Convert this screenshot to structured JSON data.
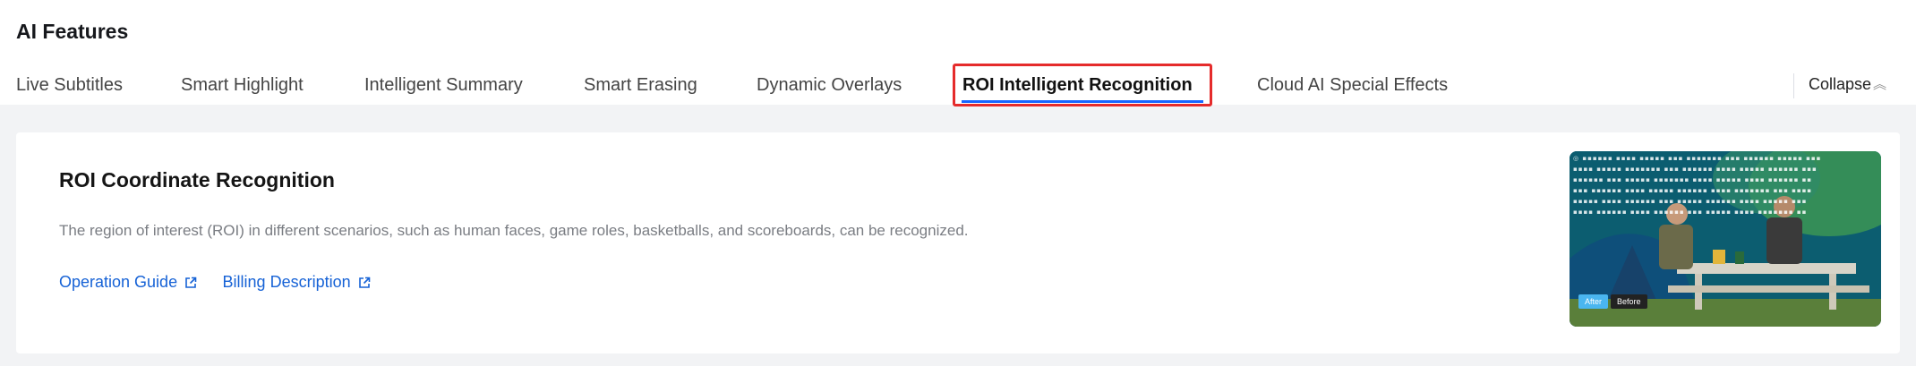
{
  "page": {
    "title": "AI Features"
  },
  "tabs": [
    {
      "label": "Live Subtitles",
      "active": false
    },
    {
      "label": "Smart Highlight",
      "active": false
    },
    {
      "label": "Intelligent Summary",
      "active": false
    },
    {
      "label": "Smart Erasing",
      "active": false
    },
    {
      "label": "Dynamic Overlays",
      "active": false
    },
    {
      "label": "ROI Intelligent Recognition",
      "active": true
    },
    {
      "label": "Cloud AI Special Effects",
      "active": false
    }
  ],
  "collapse": {
    "label": "Collapse",
    "icon": "double-chevron-up-icon"
  },
  "card": {
    "title": "ROI Coordinate Recognition",
    "description": "The region of interest (ROI) in different scenarios, such as human faces, game roles, basketballs, and scoreboards, can be recognized.",
    "links": [
      {
        "label": "Operation Guide",
        "icon": "external-link-icon"
      },
      {
        "label": "Billing Description",
        "icon": "external-link-icon"
      }
    ],
    "preview": {
      "after_label": "After",
      "before_label": "Before"
    }
  },
  "colors": {
    "accent": "#1664ff",
    "link": "#1662d6",
    "highlight_border": "#e52b2b"
  }
}
